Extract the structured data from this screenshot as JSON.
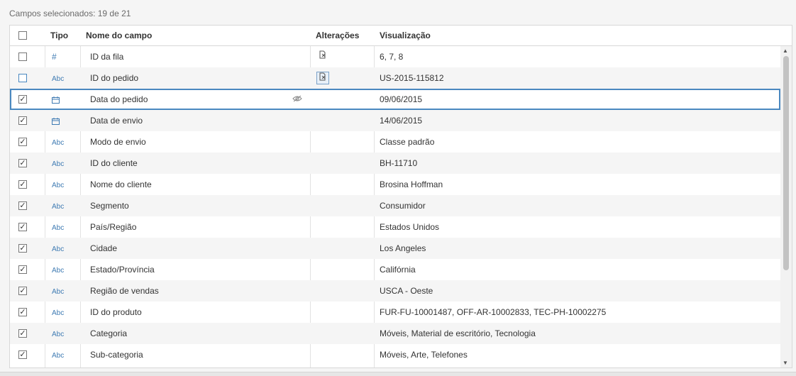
{
  "summary": "Campos selecionados: 19 de 21",
  "columns": {
    "tipo": "Tipo",
    "nome": "Nome do campo",
    "alteracoes": "Alterações",
    "visualizacao": "Visualização"
  },
  "colors": {
    "accent": "#4a88c0",
    "type_icon": "#3f7bb3"
  },
  "rows": [
    {
      "checked": false,
      "type": "#",
      "name": "ID da fila",
      "preview": "6, 7, 8"
    },
    {
      "checked": false,
      "type": "Abc",
      "name": "ID do pedido",
      "preview": "US-2015-115812"
    },
    {
      "checked": true,
      "type": "date",
      "name": "Data do pedido",
      "preview": "09/06/2015"
    },
    {
      "checked": true,
      "type": "date",
      "name": "Data de envio",
      "preview": "14/06/2015"
    },
    {
      "checked": true,
      "type": "Abc",
      "name": "Modo de envio",
      "preview": "Classe padrão"
    },
    {
      "checked": true,
      "type": "Abc",
      "name": "ID do cliente",
      "preview": "BH-11710"
    },
    {
      "checked": true,
      "type": "Abc",
      "name": "Nome do cliente",
      "preview": "Brosina Hoffman"
    },
    {
      "checked": true,
      "type": "Abc",
      "name": "Segmento",
      "preview": "Consumidor"
    },
    {
      "checked": true,
      "type": "Abc",
      "name": "País/Região",
      "preview": "Estados Unidos"
    },
    {
      "checked": true,
      "type": "Abc",
      "name": "Cidade",
      "preview": "Los Angeles"
    },
    {
      "checked": true,
      "type": "Abc",
      "name": "Estado/Província",
      "preview": "Califórnia"
    },
    {
      "checked": true,
      "type": "Abc",
      "name": "Região de vendas",
      "preview": "USCA - Oeste"
    },
    {
      "checked": true,
      "type": "Abc",
      "name": "ID do produto",
      "preview": "FUR-FU-10001487, OFF-AR-10002833, TEC-PH-10002275"
    },
    {
      "checked": true,
      "type": "Abc",
      "name": "Categoria",
      "preview": "Móveis, Material de escritório, Tecnologia"
    },
    {
      "checked": true,
      "type": "Abc",
      "name": "Sub-categoria",
      "preview": "Móveis, Arte, Telefones"
    }
  ]
}
